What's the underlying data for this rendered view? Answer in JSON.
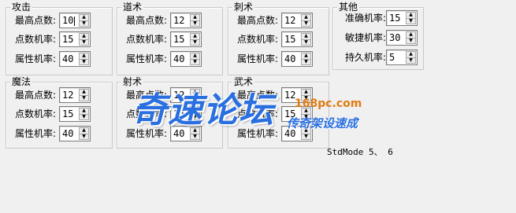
{
  "groups": [
    {
      "title": "攻击",
      "rows": [
        {
          "label": "最高点数:",
          "value": "10"
        },
        {
          "label": "点数机率:",
          "value": "15"
        },
        {
          "label": "属性机率:",
          "value": "40"
        }
      ]
    },
    {
      "title": "道术",
      "rows": [
        {
          "label": "最高点数:",
          "value": "12"
        },
        {
          "label": "点数机率:",
          "value": "15"
        },
        {
          "label": "属性机率:",
          "value": "40"
        }
      ]
    },
    {
      "title": "刺术",
      "rows": [
        {
          "label": "最高点数:",
          "value": "12"
        },
        {
          "label": "点数机率:",
          "value": "15"
        },
        {
          "label": "属性机率:",
          "value": "40"
        }
      ]
    },
    {
      "title": "其他",
      "rows": [
        {
          "label": "准确机率:",
          "value": "15"
        },
        {
          "label": "敏捷机率:",
          "value": "30"
        },
        {
          "label": "持久机率:",
          "value": "5"
        }
      ]
    },
    {
      "title": "魔法",
      "rows": [
        {
          "label": "最高点数:",
          "value": "12"
        },
        {
          "label": "点数机率:",
          "value": "15"
        },
        {
          "label": "属性机率:",
          "value": "40"
        }
      ]
    },
    {
      "title": "射术",
      "rows": [
        {
          "label": "最高点数:",
          "value": "12"
        },
        {
          "label": "点数机率:",
          "value": "15"
        },
        {
          "label": "属性机率:",
          "value": "40"
        }
      ]
    },
    {
      "title": "武术",
      "rows": [
        {
          "label": "最高点数:",
          "value": "12"
        },
        {
          "label": "点数机率:",
          "value": "15"
        },
        {
          "label": "属性机率:",
          "value": "40"
        }
      ]
    }
  ],
  "stdmode_text": "StdMode 5、 6",
  "watermark": {
    "main": "奇速论坛",
    "url": "168pc.com",
    "sub": "传奇架设速成"
  }
}
